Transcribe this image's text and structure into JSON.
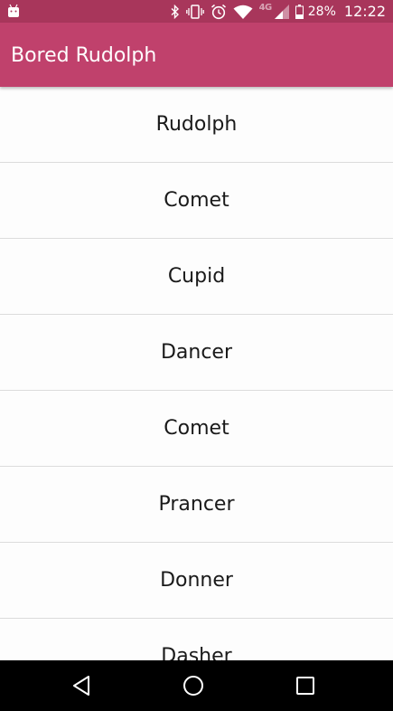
{
  "status_bar": {
    "network_label": "4G",
    "battery_percent": "28%",
    "time": "12:22"
  },
  "app_bar": {
    "title": "Bored Rudolph"
  },
  "reindeer": [
    "Rudolph",
    "Comet",
    "Cupid",
    "Dancer",
    "Comet",
    "Prancer",
    "Donner",
    "Dasher"
  ],
  "icons": {
    "notification": "android-icon",
    "bluetooth": "bluetooth-icon",
    "vibrate": "vibrate-icon",
    "alarm": "alarm-icon",
    "wifi": "wifi-icon",
    "signal": "signal-icon",
    "battery": "battery-icon",
    "nav_back": "back-triangle-icon",
    "nav_home": "home-circle-icon",
    "nav_recents": "recents-square-icon"
  },
  "colors": {
    "status_bar": "#a8365b",
    "app_bar": "#c0416c",
    "list_background": "#fdfdfd",
    "divider": "#dcdcdc",
    "nav_bar": "#000000"
  }
}
